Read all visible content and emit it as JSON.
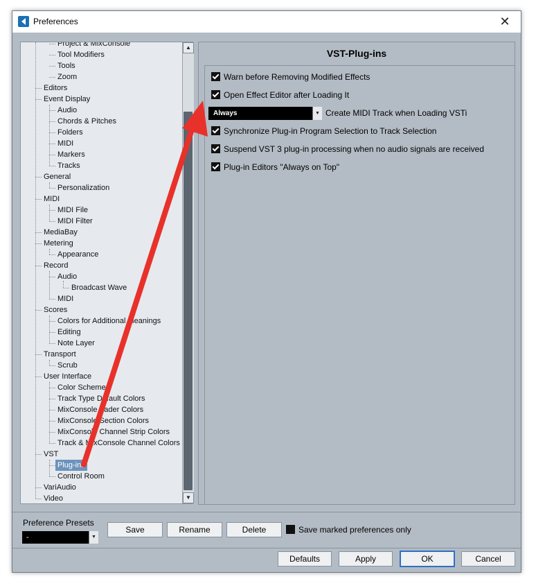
{
  "window": {
    "title": "Preferences"
  },
  "tree": {
    "items": [
      {
        "label": "Project & MixConsole",
        "level": 2
      },
      {
        "label": "Tool Modifiers",
        "level": 2
      },
      {
        "label": "Tools",
        "level": 2
      },
      {
        "label": "Zoom",
        "level": 2
      },
      {
        "label": "Editors",
        "level": 1
      },
      {
        "label": "Event Display",
        "level": 1
      },
      {
        "label": "Audio",
        "level": 2
      },
      {
        "label": "Chords & Pitches",
        "level": 2
      },
      {
        "label": "Folders",
        "level": 2
      },
      {
        "label": "MIDI",
        "level": 2
      },
      {
        "label": "Markers",
        "level": 2
      },
      {
        "label": "Tracks",
        "level": 2
      },
      {
        "label": "General",
        "level": 1
      },
      {
        "label": "Personalization",
        "level": 2
      },
      {
        "label": "MIDI",
        "level": 1
      },
      {
        "label": "MIDI File",
        "level": 2
      },
      {
        "label": "MIDI Filter",
        "level": 2
      },
      {
        "label": "MediaBay",
        "level": 1
      },
      {
        "label": "Metering",
        "level": 1
      },
      {
        "label": "Appearance",
        "level": 2
      },
      {
        "label": "Record",
        "level": 1
      },
      {
        "label": "Audio",
        "level": 2
      },
      {
        "label": "Broadcast Wave",
        "level": 3
      },
      {
        "label": "MIDI",
        "level": 2
      },
      {
        "label": "Scores",
        "level": 1
      },
      {
        "label": "Colors for Additional Meanings",
        "level": 2
      },
      {
        "label": "Editing",
        "level": 2
      },
      {
        "label": "Note Layer",
        "level": 2
      },
      {
        "label": "Transport",
        "level": 1
      },
      {
        "label": "Scrub",
        "level": 2
      },
      {
        "label": "User Interface",
        "level": 1
      },
      {
        "label": "Color Schemes",
        "level": 2
      },
      {
        "label": "Track Type Default Colors",
        "level": 2
      },
      {
        "label": "MixConsole Fader Colors",
        "level": 2
      },
      {
        "label": "MixConsole Section Colors",
        "level": 2
      },
      {
        "label": "MixConsole Channel Strip Colors",
        "level": 2
      },
      {
        "label": "Track & MixConsole Channel Colors",
        "level": 2
      },
      {
        "label": "VST",
        "level": 1
      },
      {
        "label": "Plug-ins",
        "level": 2,
        "selected": true
      },
      {
        "label": "Control Room",
        "level": 2
      },
      {
        "label": "VariAudio",
        "level": 1
      },
      {
        "label": "Video",
        "level": 1
      }
    ]
  },
  "panel": {
    "title": "VST-Plug-ins",
    "options": [
      {
        "label": "Warn before Removing Modified Effects",
        "checked": true
      },
      {
        "label": "Open Effect Editor after Loading It",
        "checked": true
      },
      {
        "label": "Synchronize Plug-in Program Selection to Track Selection",
        "checked": true
      },
      {
        "label": "Suspend VST 3 plug-in processing when no audio signals are received",
        "checked": true
      },
      {
        "label": "Plug-in Editors \"Always on Top\"",
        "checked": true
      }
    ],
    "midi_track": {
      "value": "Always",
      "label": "Create MIDI Track when Loading VSTi"
    }
  },
  "presets": {
    "label": "Preference Presets",
    "value": "-",
    "save": "Save",
    "rename": "Rename",
    "delete": "Delete",
    "save_marked": "Save marked preferences only"
  },
  "footer": {
    "defaults": "Defaults",
    "apply": "Apply",
    "ok": "OK",
    "cancel": "Cancel"
  },
  "colors": {
    "annotation_arrow": "#e8312a",
    "selection": "#6c93bd",
    "panel_bg": "#b3bcc4"
  },
  "icons": {
    "app": "cubase-icon",
    "close": "close-icon",
    "scroll_up": "chevron-up-icon",
    "scroll_down": "chevron-down-icon",
    "dropdown": "chevron-down-icon"
  }
}
